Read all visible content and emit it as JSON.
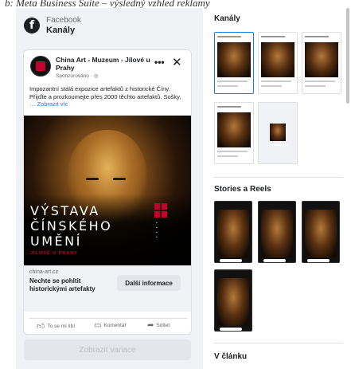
{
  "caption": "b: Meta Business Suite – výsledný vzhled reklamy",
  "preview": {
    "platform": "Facebook",
    "placement": "Kanály",
    "ad": {
      "page_name": "China Art - Muzeum - Jílové u Prahy",
      "sponsored": "Sponzorováno · ◎",
      "primary_text": "Impozantní stálá expozice artefaktů z historické Číny. Přijďte a prozkoumejte přes 2000 těchto artefaktů. Sošky,",
      "see_more": "… Zobrazit víc",
      "image_title": "VÝSTAVA ČÍNSKÉHO UMĚNÍ",
      "image_subtitle": "JÍLOVÉ U PRAHY",
      "domain": "china-art.cz",
      "headline": "Nechte se pohltit historickými artefakty",
      "cta": "Další informace",
      "actions": {
        "like": "To se mi líbí",
        "comment": "Komentář",
        "share": "Sdílet"
      }
    },
    "variants_button": "Zobrazit variace"
  },
  "placements": {
    "feeds_title": "Kanály",
    "stories_title": "Stories a Reels",
    "articles_title": "V článku"
  }
}
